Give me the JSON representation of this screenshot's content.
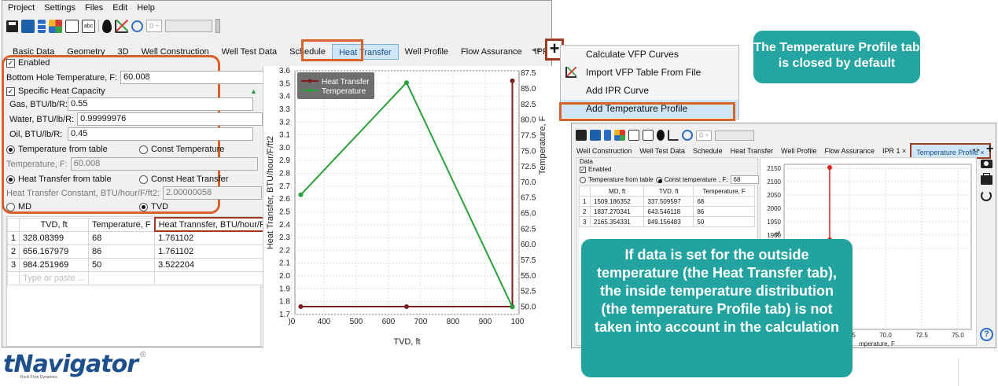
{
  "menubar": [
    "Project",
    "Settings",
    "Files",
    "Edit",
    "Help"
  ],
  "toolbar": {
    "spin_value": "0",
    "spin_arrow": "÷"
  },
  "main_tabs": [
    {
      "label": "Basic Data"
    },
    {
      "label": "Geometry"
    },
    {
      "label": "3D"
    },
    {
      "label": "Well Construction"
    },
    {
      "label": "Well Test Data"
    },
    {
      "label": "Schedule"
    },
    {
      "label": "Heat Transfer"
    },
    {
      "label": "Well Profile"
    },
    {
      "label": "Flow Assurance"
    },
    {
      "label": "IPR 1 ×"
    }
  ],
  "add_tab_button": "+",
  "nav_arrows": "◂ ▸",
  "settings": {
    "enabled": "Enabled",
    "bh_temp_label": "Bottom Hole Temperature, F:",
    "bh_temp_value": "60.008",
    "specific_heat": "Specific Heat Capacity",
    "gas_label": "Gas, BTU/lb/R:",
    "gas_value": "0.55",
    "water_label": "Water, BTU/lb/R:",
    "water_value": "0.99999976",
    "oil_label": "Oil, BTU/lb/R:",
    "oil_value": "0.45",
    "temp_from_table": "Temperature from table",
    "const_temp": "Const Temperature",
    "temp_label": "Temperature, F:",
    "temp_value": "60.008",
    "ht_from_table": "Heat Transfer from table",
    "const_ht": "Const Heat Transfer",
    "ht_const_label": "Heat Transfer Constant, BTU/hour/F/ft2:",
    "ht_const_value": "2.00000058",
    "md": "MD",
    "tvd": "TVD"
  },
  "ht_table": {
    "headers": [
      "TVD, ft",
      "Temperature, F",
      "Heat Trannsfer, BTU/hour/F/ft2"
    ],
    "rows": [
      [
        "1",
        "328.08399",
        "68",
        "1.761102"
      ],
      [
        "2",
        "656.167979",
        "86",
        "1.761102"
      ],
      [
        "3",
        "984.251969",
        "50",
        "3.522204"
      ]
    ],
    "placeholder": "Type or paste ..."
  },
  "chart_data": {
    "type": "line",
    "xlabel": "TVD, ft",
    "ylabel": "Heat Transfer, BTU/hour/F/ft2",
    "y2label": "Temperature, F",
    "x_ticks": [
      "300",
      "400",
      "500",
      "600",
      "700",
      "800",
      "900",
      "1000"
    ],
    "x_tick_labels": [
      ")0",
      "400",
      "500",
      "600",
      "700",
      "800",
      "900",
      "100"
    ],
    "y_ticks": [
      "1.7",
      "1.8",
      "1.9",
      "2.0",
      "2.1",
      "2.2",
      "2.3",
      "2.4",
      "2.5",
      "2.6",
      "2.7",
      "2.8",
      "2.9",
      "3.0",
      "3.1",
      "3.2",
      "3.3",
      "3.4",
      "3.5",
      "3.6"
    ],
    "y2_ticks": [
      "50.0",
      "52.5",
      "55.0",
      "57.5",
      "60.0",
      "62.5",
      "65.0",
      "67.5",
      "70.0",
      "72.5",
      "75.0",
      "77.5",
      "80.0",
      "82.5",
      "85.0",
      "87.5"
    ],
    "xlim": [
      310,
      1005
    ],
    "ylim": [
      1.7,
      3.6
    ],
    "y2lim": [
      48.8,
      87.9
    ],
    "series": [
      {
        "name": "Heat Transfer",
        "color": "#7b1f1f",
        "x": [
          328.08399,
          656.167979,
          984.251969,
          984.251969
        ],
        "y": [
          1.761102,
          1.761102,
          1.761102,
          3.522204
        ]
      },
      {
        "name": "Temperature",
        "color": "#2aa03a",
        "axis": "y2",
        "x": [
          328.08399,
          656.167979,
          984.251969
        ],
        "y": [
          68,
          86,
          50
        ]
      }
    ],
    "legend": "top-left",
    "grid": true
  },
  "dropdown_menu": {
    "items": [
      "Calculate VFP Curves",
      "Import VFP Table From File",
      "Add IPR Curve",
      "Add Temperature Profile"
    ]
  },
  "callout_top": "The Temperature Profile tab is closed by default",
  "callout_bottom": "If data is set for the outside temperature (the Heat Transfer tab), the inside temperature distribution (the temperature Profile tab) is not taken into account in the calculation",
  "second_window": {
    "tabs": [
      "Well Construction",
      "Well Test Data",
      "Schedule",
      "Heat Transfer",
      "Well Profile",
      "Flow Assurance",
      "IPR 1 ×",
      "Temperature Profile ×"
    ],
    "data_label": "Data",
    "enabled": "Enabled",
    "temp_from_table": "Temperature from table",
    "const_temp": "Const temperature",
    "f_label": ", F:",
    "f_value": "68",
    "table_headers": [
      "MD, ft",
      "TVD, ft",
      "Temperature, F"
    ],
    "table_rows": [
      [
        "1",
        "1509.186352",
        "337.509597",
        "68"
      ],
      [
        "2",
        "1837.270341",
        "643.546118",
        "86"
      ],
      [
        "3",
        "2165.354331",
        "949.156483",
        "50"
      ]
    ],
    "y_ticks": [
      "2150",
      "2100",
      "2050",
      "2000",
      "1950",
      "1900",
      "1850"
    ],
    "x_ticks": [
      "67.5",
      "70.0",
      "72.5",
      "75.0"
    ],
    "xlabel_partial": "mperature, F",
    "y_partial_label": "ef"
  },
  "logo": {
    "text": "tNavigator",
    "reg": "®",
    "subtitle": "Rock Flow Dynamics"
  }
}
